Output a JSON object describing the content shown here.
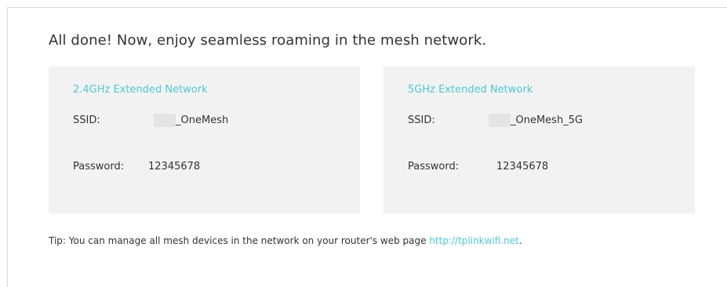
{
  "headline": "All done! Now, enjoy seamless roaming in the mesh network.",
  "networks": [
    {
      "title": "2.4GHz Extended Network",
      "ssid_label": "SSID:",
      "ssid_value": "_OneMesh",
      "password_label": "Password:",
      "password_value": "12345678"
    },
    {
      "title": "5GHz Extended Network",
      "ssid_label": "SSID:",
      "ssid_value": "_OneMesh_5G",
      "password_label": "Password:",
      "password_value": "12345678"
    }
  ],
  "tip": {
    "text": "Tip: You can manage all mesh devices in the network on your router's web page ",
    "link": "http://tplinkwifi.net",
    "suffix": "."
  },
  "colors": {
    "accent": "#4acbd6",
    "card_bg": "#f2f2f2",
    "text": "#333333"
  }
}
